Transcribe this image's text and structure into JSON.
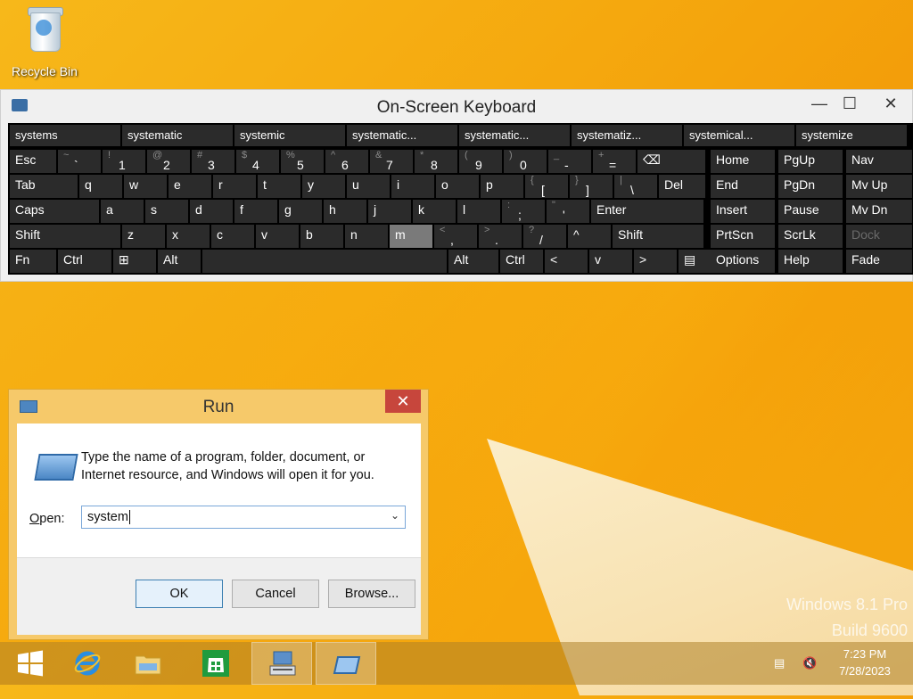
{
  "desktop": {
    "recycle_bin_label": "Recycle Bin",
    "watermark_line1": "Windows 8.1 Pro",
    "watermark_line2": "Build 9600"
  },
  "osk": {
    "title": "On-Screen Keyboard",
    "suggestions": [
      "systems",
      "systematic",
      "systemic",
      "systematic...",
      "systematic...",
      "systematiz...",
      "systemical...",
      "systemize"
    ],
    "row1": [
      {
        "label": "Esc"
      },
      {
        "sub": "~",
        "main": "`"
      },
      {
        "sub": "!",
        "main": "1"
      },
      {
        "sub": "@",
        "main": "2"
      },
      {
        "sub": "#",
        "main": "3"
      },
      {
        "sub": "$",
        "main": "4"
      },
      {
        "sub": "%",
        "main": "5"
      },
      {
        "sub": "^",
        "main": "6"
      },
      {
        "sub": "&",
        "main": "7"
      },
      {
        "sub": "*",
        "main": "8"
      },
      {
        "sub": "(",
        "main": "9"
      },
      {
        "sub": ")",
        "main": "0"
      },
      {
        "sub": "_",
        "main": "-"
      },
      {
        "sub": "+",
        "main": "="
      },
      {
        "label": "⌫"
      }
    ],
    "row2": [
      "Tab",
      "q",
      "w",
      "e",
      "r",
      "t",
      "y",
      "u",
      "i",
      "o",
      "p",
      "[",
      "]",
      "\\",
      "Del"
    ],
    "row3": [
      "Caps",
      "a",
      "s",
      "d",
      "f",
      "g",
      "h",
      "j",
      "k",
      "l",
      ";",
      "'",
      "Enter"
    ],
    "row4": [
      "Shift",
      "z",
      "x",
      "c",
      "v",
      "b",
      "n",
      "m",
      ",",
      ".",
      "/",
      "^",
      "Shift"
    ],
    "row5": [
      "Fn",
      "Ctrl",
      "⊞",
      "Alt",
      "",
      "Alt",
      "Ctrl",
      "<",
      "v",
      ">",
      "▤"
    ],
    "row2_subs": {
      "[": "{",
      "]": "}",
      "\\": "|"
    },
    "row3_subs": {
      ";": ":",
      "'": "\""
    },
    "row4_subs": {
      ",": "<",
      ".": ">",
      "/": "?"
    },
    "nav": [
      [
        "Home",
        "PgUp",
        "Nav"
      ],
      [
        "End",
        "PgDn",
        "Mv Up"
      ],
      [
        "Insert",
        "Pause",
        "Mv Dn"
      ],
      [
        "PrtScn",
        "ScrLk",
        "Dock"
      ],
      [
        "Options",
        "Help",
        "Fade"
      ]
    ]
  },
  "run": {
    "title": "Run",
    "description": "Type the name of a program, folder, document, or Internet resource, and Windows will open it for you.",
    "open_label": "Open:",
    "input_value": "system",
    "ok_label": "OK",
    "cancel_label": "Cancel",
    "browse_label": "Browse..."
  },
  "taskbar": {
    "time": "7:23 PM",
    "date": "7/28/2023"
  }
}
